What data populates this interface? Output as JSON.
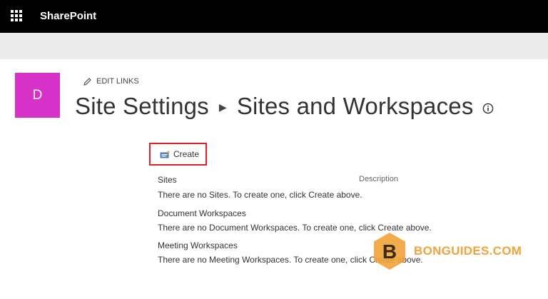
{
  "suitebar": {
    "app_name": "SharePoint",
    "launcher_icon": "app-launcher-icon"
  },
  "site": {
    "logo_letter": "D",
    "logo_color": "#d631c9"
  },
  "edit_links": {
    "label": "EDIT LINKS",
    "icon": "pencil-icon"
  },
  "breadcrumb": {
    "parent": "Site Settings",
    "current": "Sites and Workspaces",
    "info_icon": "info-icon"
  },
  "toolbar": {
    "create_label": "Create",
    "create_icon": "create-site-icon",
    "highlight_color": "#e01f26"
  },
  "table": {
    "description_header": "Description",
    "sections": [
      {
        "heading": "Sites",
        "empty_message": "There are no Sites. To create one, click Create above."
      },
      {
        "heading": "Document Workspaces",
        "empty_message": "There are no Document Workspaces. To create one, click Create above."
      },
      {
        "heading": "Meeting Workspaces",
        "empty_message": "There are no Meeting Workspaces. To create one, click Create above."
      }
    ]
  },
  "watermark": {
    "text": "BONGUIDES.COM",
    "color": "#f2a33a"
  }
}
